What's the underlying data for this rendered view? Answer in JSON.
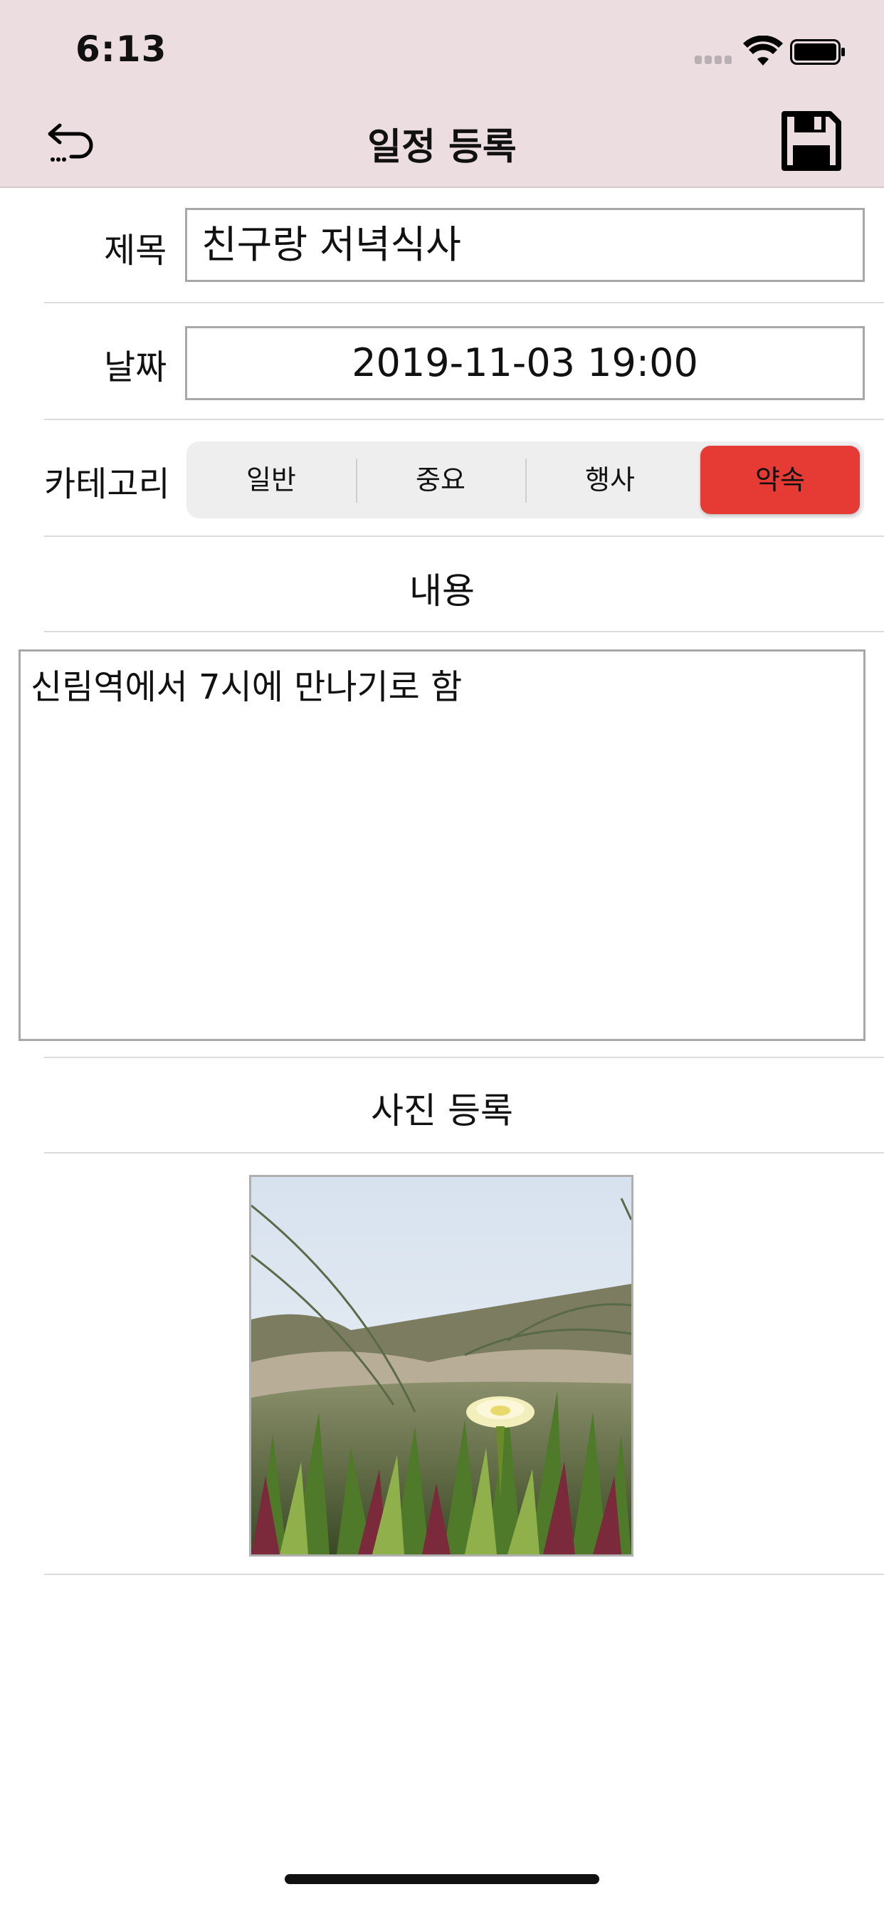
{
  "status_bar": {
    "time": "6:13"
  },
  "nav": {
    "title": "일정 등록"
  },
  "form": {
    "title_label": "제목",
    "title_value": "친구랑 저녁식사",
    "date_label": "날짜",
    "date_value": "2019-11-03 19:00",
    "category_label": "카테고리",
    "categories": [
      "일반",
      "중요",
      "행사",
      "약속"
    ],
    "selected_category": "약속",
    "content_header": "내용",
    "content_value": "신림역에서 7시에 만나기로 함",
    "photo_header": "사진 등록"
  },
  "colors": {
    "bar_background": "#ecdde0",
    "selected_segment": "#e63a35"
  }
}
